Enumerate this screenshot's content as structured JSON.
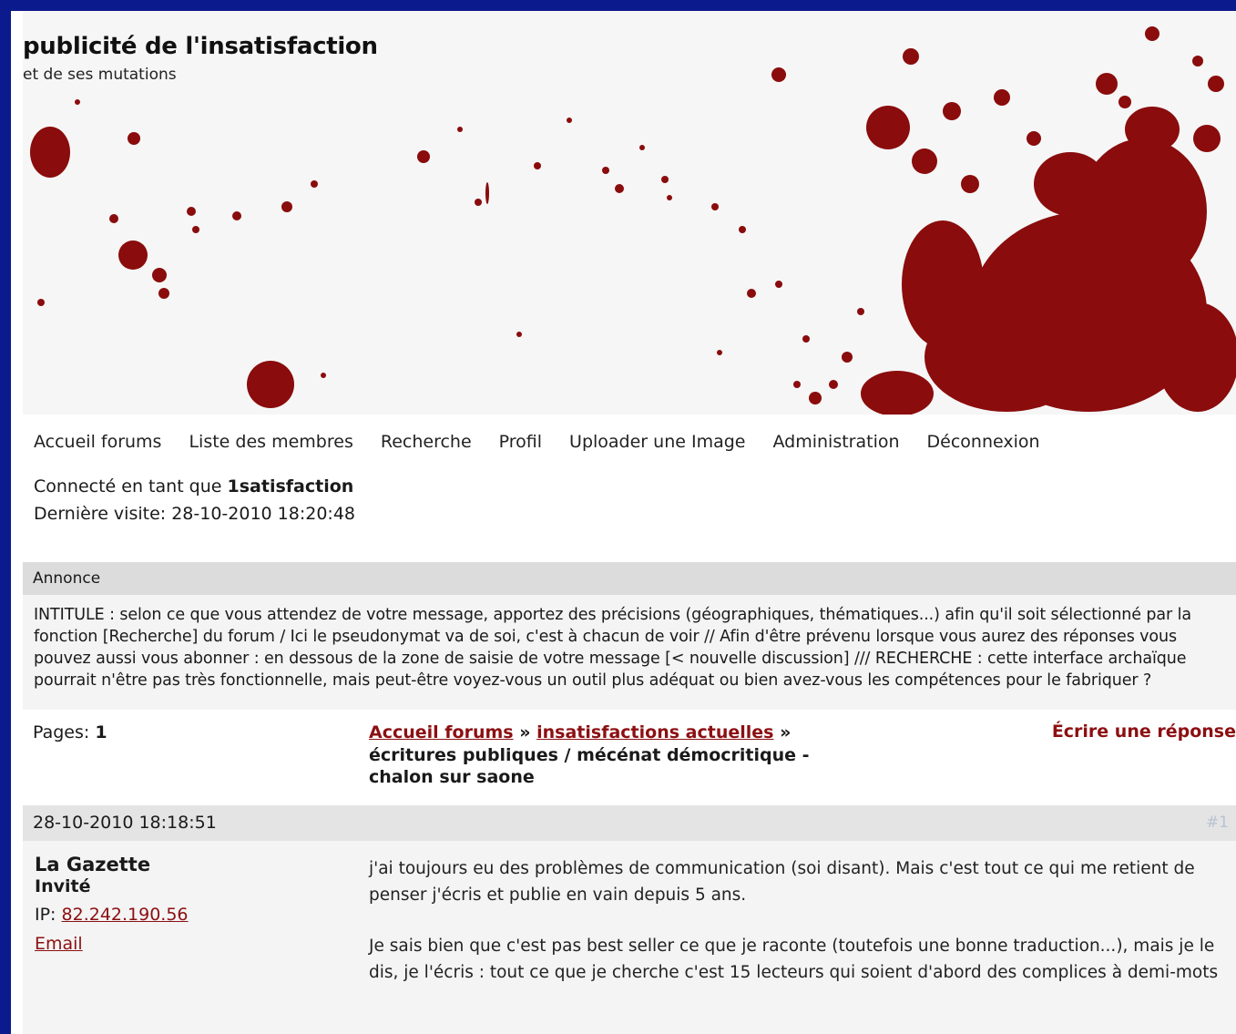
{
  "header": {
    "title": "publicité de l'insatisfaction",
    "subtitle": "et de ses mutations",
    "accent_color": "#8c0f12"
  },
  "nav": {
    "items": [
      "Accueil forums",
      "Liste des membres",
      "Recherche",
      "Profil",
      "Uploader une Image",
      "Administration",
      "Déconnexion"
    ]
  },
  "status": {
    "logged_prefix": "Connecté en tant que",
    "username": "1satisfaction",
    "last_visit": "Dernière visite: 28-10-2010 18:20:48"
  },
  "announcement": {
    "heading": "Annonce",
    "text": "INTITULE : selon ce que vous attendez de votre message, apportez des précisions (géographiques, thématiques...) afin qu'il soit sélectionné par la fonction [Recherche] du forum / Ici le pseudonymat va de soi, c'est à chacun de voir // Afin d'être prévenu lorsque vous aurez des réponses vous pouvez aussi vous abonner : en dessous de la zone de saisie de votre message [< nouvelle discussion] /// RECHERCHE : cette interface archaïque pourrait n'être pas très fonctionnelle, mais peut-être voyez-vous un outil plus adéquat ou bien avez-vous les compétences pour le fabriquer ?"
  },
  "linkrow": {
    "pages_label": "Pages:",
    "pages_value": "1",
    "crumb_home": "Accueil forums",
    "crumb_sep1": " » ",
    "crumb_forum": "insatisfactions actuelles",
    "crumb_sep2": " » ",
    "crumb_topic": "écritures publiques / mécénat démocritique - chalon sur saone",
    "reply_label": "Écrire une réponse"
  },
  "post": {
    "date": "28-10-2010 18:18:51",
    "number": "#1",
    "author_name": "La Gazette",
    "author_rank": "Invité",
    "ip_label": "IP:",
    "ip_value": "82.242.190.56",
    "email_label": "Email",
    "paragraphs": [
      "j'ai toujours eu des problèmes de communication (soi disant). Mais c'est tout ce qui me retient de penser j'écris et publie en vain depuis 5 ans.",
      "Je sais bien que c'est pas best seller ce que je raconte (toutefois une bonne traduction...), mais je le dis, je l'écris : tout ce que je cherche c'est 15 lecteurs qui soient d'abord des complices à demi-mots"
    ]
  }
}
